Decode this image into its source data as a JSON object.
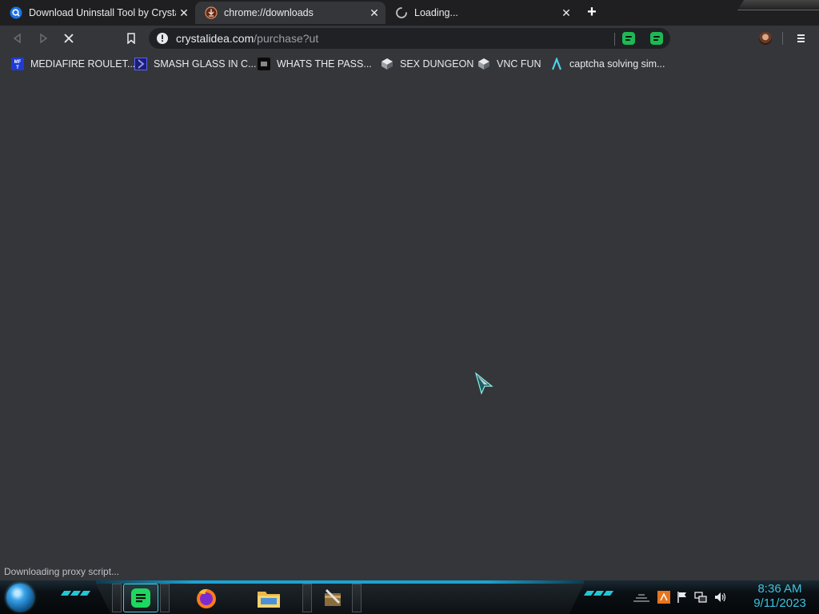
{
  "tabs": [
    {
      "title": "Download Uninstall Tool by Crystal",
      "favicon": "search-favicon",
      "active": false
    },
    {
      "title": "chrome://downloads",
      "favicon": "downloads-favicon",
      "active": true
    },
    {
      "title": "Loading...",
      "favicon": "loading-spinner",
      "active": false
    }
  ],
  "toolbar": {
    "url_host": "crystalidea.com",
    "url_path": "/purchase?ut",
    "loading": true
  },
  "bookmarks": [
    {
      "label": "MEDIAFIRE ROULET...",
      "icon": "mediafire-icon"
    },
    {
      "label": "SMASH GLASS IN C...",
      "icon": "chevron-bookmark-icon"
    },
    {
      "label": "WHATS THE PASS...",
      "icon": "dark-site-icon"
    },
    {
      "label": "SEX DUNGEON",
      "icon": "cube-icon"
    },
    {
      "label": "VNC FUN",
      "icon": "cube-icon"
    },
    {
      "label": "captcha solving sim...",
      "icon": "lambda-icon"
    }
  ],
  "status_text": "Downloading proxy script...",
  "taskbar": {
    "apps": [
      "spotify",
      "firefox",
      "file-explorer",
      "archive-tool"
    ],
    "time": "8:36 AM",
    "date": "9/11/2023"
  },
  "colors": {
    "page_bg": "#35363a",
    "tabstrip_bg": "#1f1f21",
    "omnibox_bg": "#202124",
    "accent_green": "#1db954",
    "clock_cyan": "#39c4e0"
  }
}
